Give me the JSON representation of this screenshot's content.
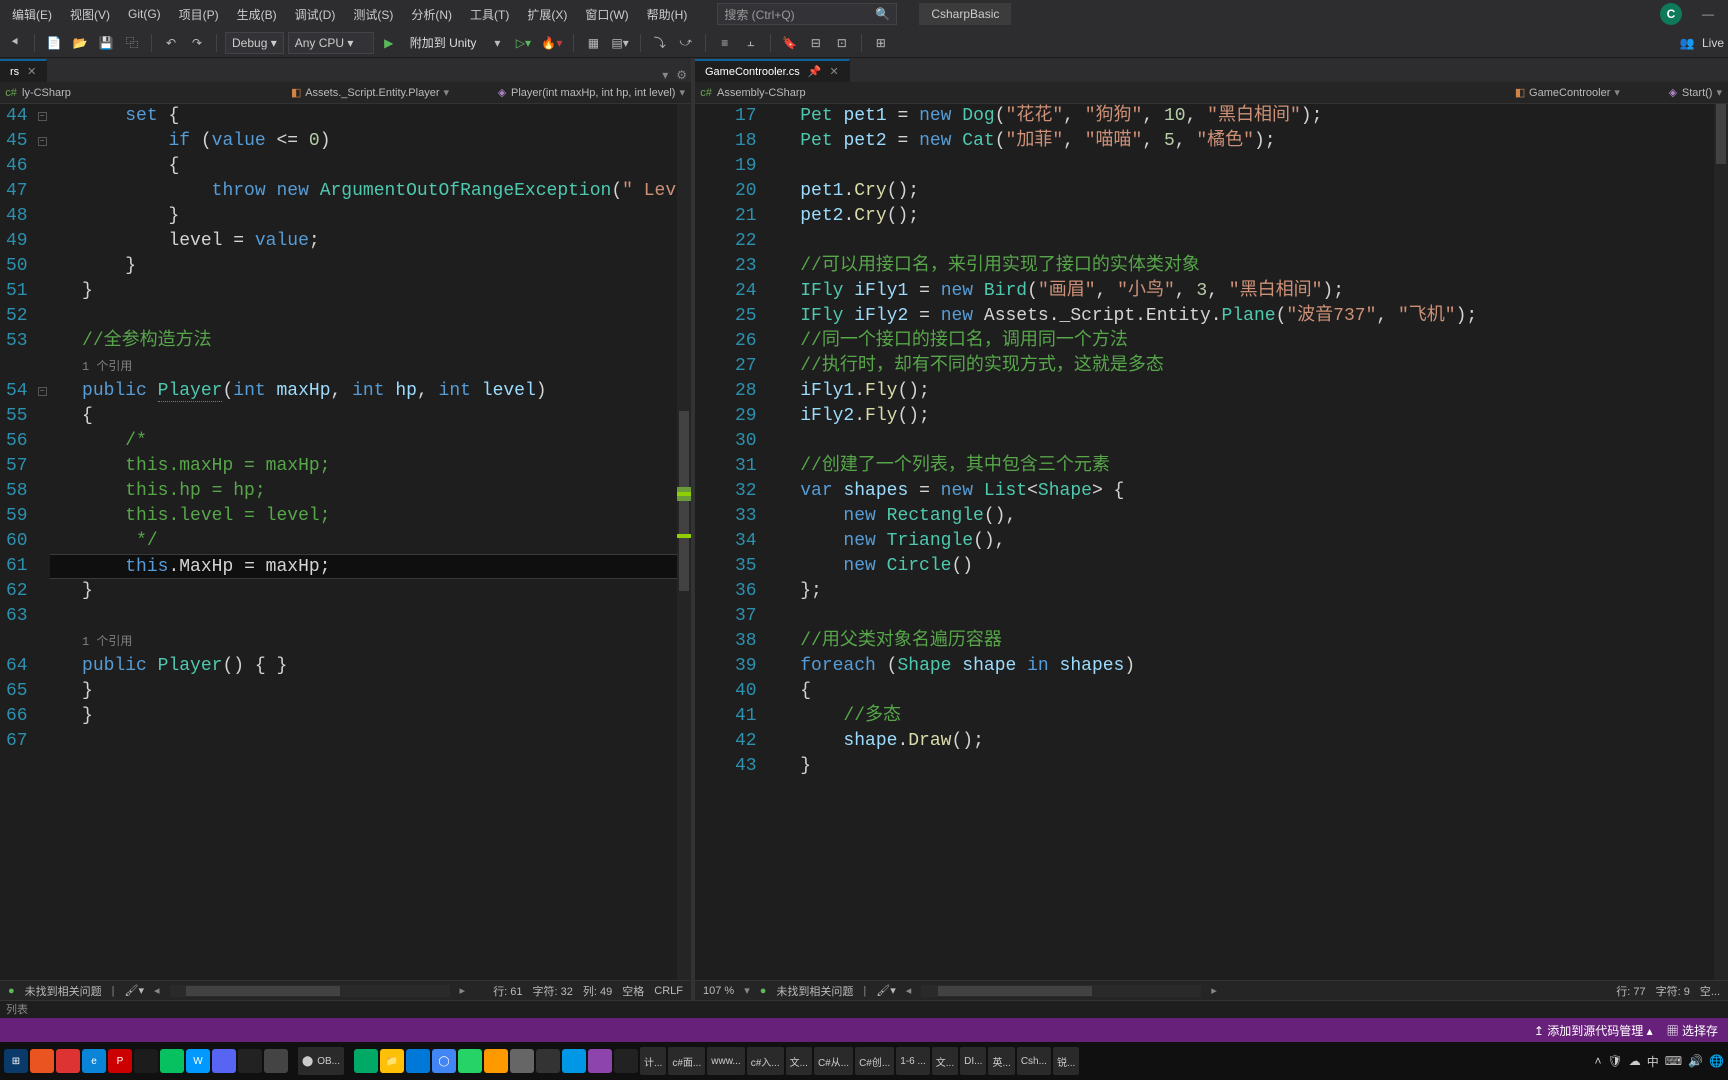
{
  "menubar": {
    "items": [
      {
        "label": "编辑(E)"
      },
      {
        "label": "视图(V)"
      },
      {
        "label": "Git(G)"
      },
      {
        "label": "项目(P)"
      },
      {
        "label": "生成(B)"
      },
      {
        "label": "调试(D)"
      },
      {
        "label": "测试(S)"
      },
      {
        "label": "分析(N)"
      },
      {
        "label": "工具(T)"
      },
      {
        "label": "扩展(X)"
      },
      {
        "label": "窗口(W)"
      },
      {
        "label": "帮助(H)"
      }
    ],
    "search_placeholder": "搜索 (Ctrl+Q)",
    "project": "CsharpBasic",
    "avatar": "C"
  },
  "toolbar": {
    "config": "Debug",
    "platform": "Any CPU",
    "start": "附加到 Unity",
    "liveshare": "Live"
  },
  "left": {
    "tab_label": "rs",
    "bc_project": "ly-CSharp",
    "bc_namespace": "Assets._Script.Entity.Player",
    "bc_member": "Player(int maxHp, int hp, int level)",
    "first_line": 44,
    "last_line": 67,
    "ref_text": "1 个引用",
    "status": {
      "issues": "未找到相关问题",
      "line": "行: 61",
      "char": "字符: 32",
      "col": "列: 49",
      "spaces": "空格",
      "eol": "CRLF"
    }
  },
  "right": {
    "tab_label": "GameControoler.cs",
    "bc_project": "Assembly-CSharp",
    "bc_class": "GameControoler",
    "bc_member": "Start()",
    "first_line": 17,
    "last_line": 43,
    "status": {
      "zoom": "107 %",
      "issues": "未找到相关问题",
      "line": "行: 77",
      "char": "字符: 9",
      "spaces": "空..."
    }
  },
  "statusbar": {
    "add_source": "添加到源代码管理",
    "select_repo": "选择存"
  },
  "taskbar": {
    "start": "开始",
    "ob": "OB...",
    "groups": [
      "计...",
      "c#面...",
      "www...",
      "c#入...",
      "文...",
      "C#从...",
      "C#创...",
      "1-6 ...",
      "文...",
      "DI...",
      "英...",
      "Csh...",
      "锐..."
    ]
  }
}
